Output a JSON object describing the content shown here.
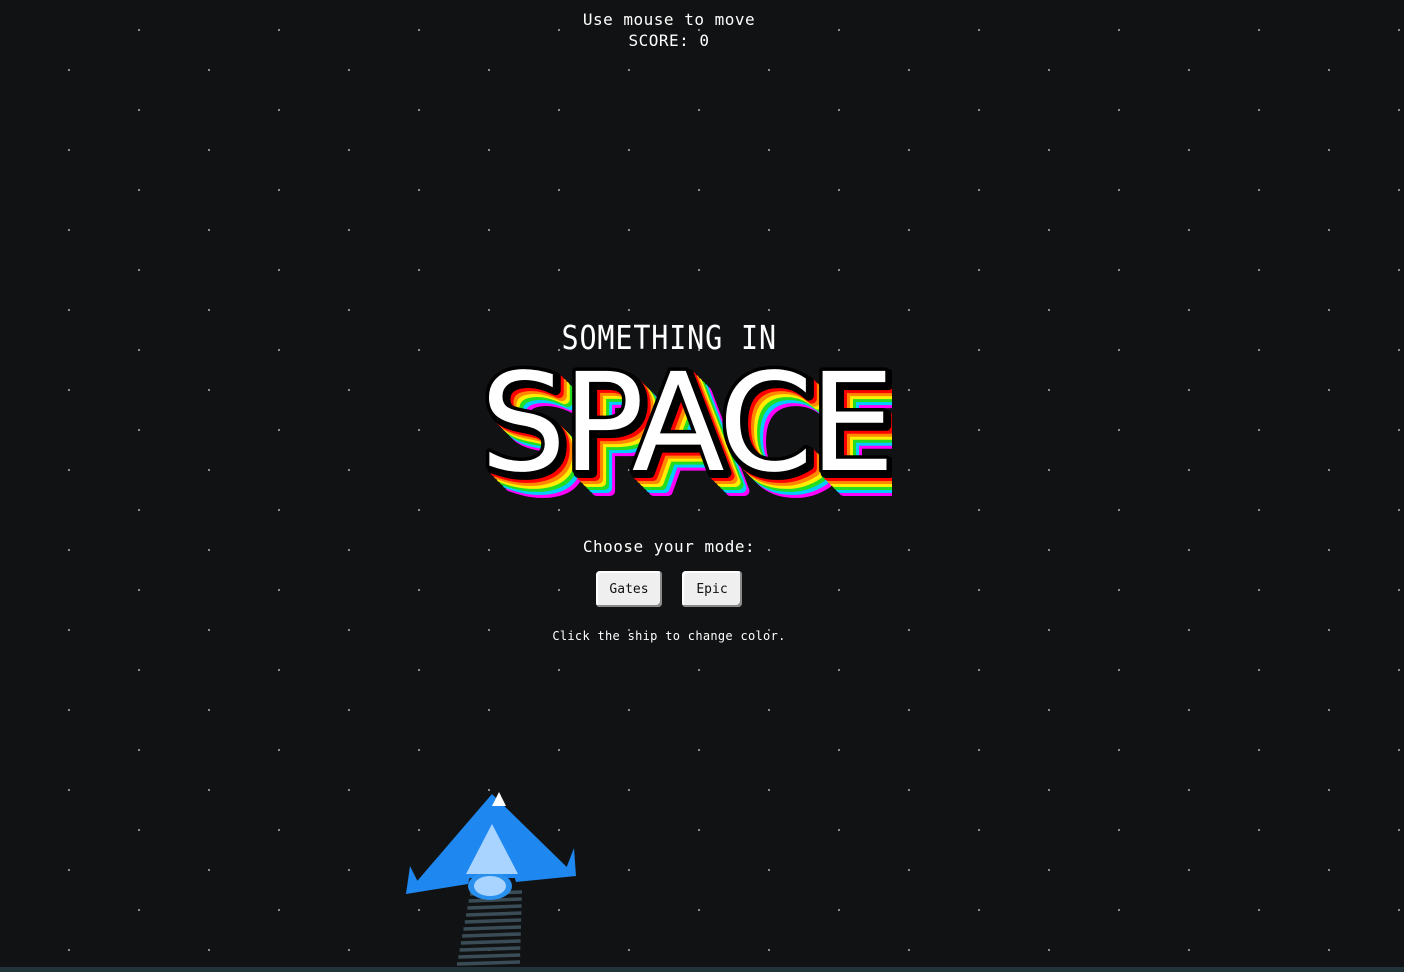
{
  "hud": {
    "instructions": "Use mouse to move",
    "score_label": "SCORE: ",
    "score_value": 0
  },
  "title": {
    "line1": "SOMETHING IN",
    "line2": "SPACE"
  },
  "mode": {
    "prompt": "Choose your mode:",
    "options": [
      "Gates",
      "Epic"
    ]
  },
  "hint": "Click the ship to change color.",
  "colors": {
    "background": "#111213",
    "star": "#9a9a9a",
    "ship_body": "#1e88f0",
    "ship_cockpit": "#a8d4ff",
    "ship_tip": "#ffffff",
    "exhaust": "#3a4d57",
    "rainbow": [
      "#ff00ff",
      "#00ccff",
      "#22dd22",
      "#ffee00",
      "#ff8800",
      "#ff0000",
      "#000000"
    ]
  },
  "ship": {
    "icon": "spaceship-icon"
  }
}
